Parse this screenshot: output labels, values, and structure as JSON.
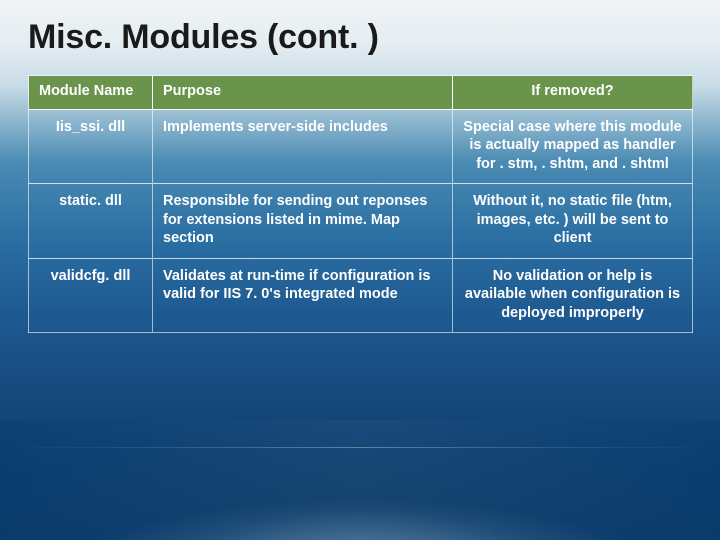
{
  "title": "Misc. Modules (cont. )",
  "table": {
    "headers": {
      "module_name": "Module Name",
      "purpose": "Purpose",
      "if_removed": "If removed?"
    },
    "rows": [
      {
        "module": "Iis_ssi. dll",
        "purpose": "Implements server-side includes",
        "removed": "Special case where this module is actually mapped as handler for . stm, . shtm, and . shtml"
      },
      {
        "module": "static. dll",
        "purpose": "Responsible for sending out reponses for extensions listed in mime. Map section",
        "removed": "Without it, no static file (htm, images, etc. ) will be sent to client"
      },
      {
        "module": "validcfg. dll",
        "purpose": "Validates at run-time if configuration is valid for IIS 7. 0's integrated mode",
        "removed": "No validation or help is available when configuration is deployed improperly"
      }
    ]
  }
}
